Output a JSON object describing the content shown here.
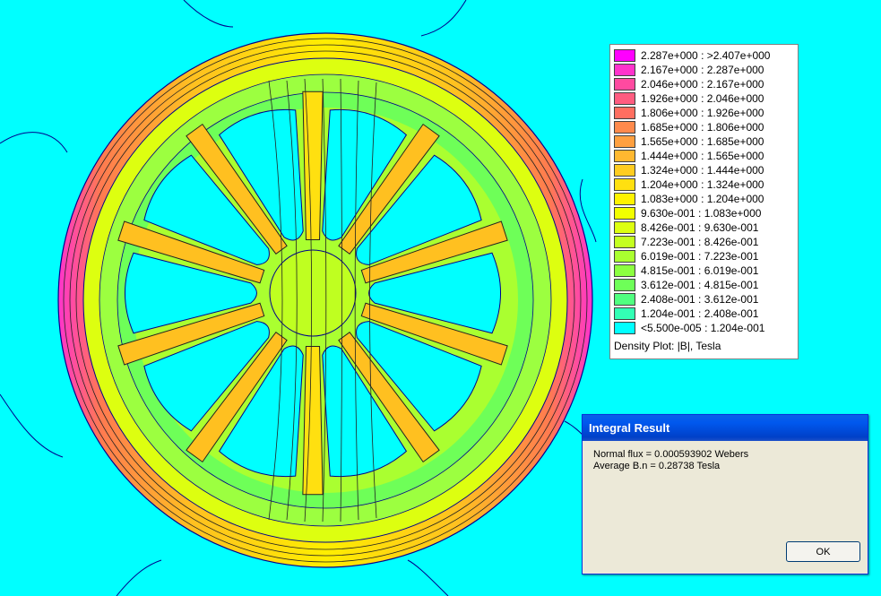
{
  "legend": {
    "rows": [
      {
        "label": "2.287e+000 : >2.407e+000",
        "color": "#FF00FF"
      },
      {
        "label": "2.167e+000 : 2.287e+000",
        "color": "#FF33CC"
      },
      {
        "label": "2.046e+000 : 2.167e+000",
        "color": "#FF4AA0"
      },
      {
        "label": "1.926e+000 : 2.046e+000",
        "color": "#FF5C80"
      },
      {
        "label": "1.806e+000 : 1.926e+000",
        "color": "#FF6E60"
      },
      {
        "label": "1.685e+000 : 1.806e+000",
        "color": "#FF8A4C"
      },
      {
        "label": "1.565e+000 : 1.685e+000",
        "color": "#FFA040"
      },
      {
        "label": "1.444e+000 : 1.565e+000",
        "color": "#FFB830"
      },
      {
        "label": "1.324e+000 : 1.444e+000",
        "color": "#FFCC20"
      },
      {
        "label": "1.204e+000 : 1.324e+000",
        "color": "#FFE010"
      },
      {
        "label": "1.083e+000 : 1.204e+000",
        "color": "#FFF200"
      },
      {
        "label": "9.630e-001 : 1.083e+000",
        "color": "#F2FF00"
      },
      {
        "label": "8.426e-001 : 9.630e-001",
        "color": "#DDFF10"
      },
      {
        "label": "7.223e-001 : 8.426e-001",
        "color": "#C4FF20"
      },
      {
        "label": "6.019e-001 : 7.223e-001",
        "color": "#AAFF30"
      },
      {
        "label": "4.815e-001 : 6.019e-001",
        "color": "#8CFF40"
      },
      {
        "label": "3.612e-001 : 4.815e-001",
        "color": "#6EFF58"
      },
      {
        "label": "2.408e-001 : 3.612e-001",
        "color": "#50FF80"
      },
      {
        "label": "1.204e-001 : 2.408e-001",
        "color": "#33FFB4"
      },
      {
        "label": "<5.500e-005 : 1.204e-001",
        "color": "#00FFFF"
      }
    ],
    "caption": "Density Plot: |B|, Tesla"
  },
  "dialog": {
    "title": "Integral Result",
    "lines": [
      "Normal flux = 0.000593902 Webers",
      "Average B.n = 0.28738 Tesla"
    ],
    "ok_label": "OK"
  },
  "plot": {
    "background_color": "#00FFFF",
    "outline_color": "#00008B",
    "spoke_count": 10
  }
}
